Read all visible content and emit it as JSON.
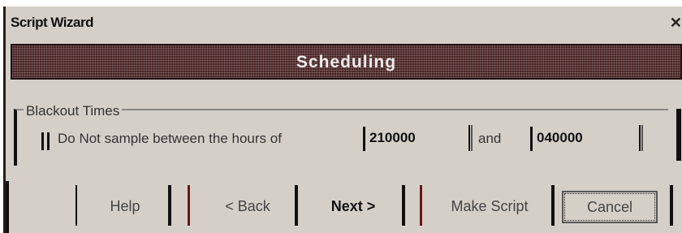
{
  "window": {
    "title": "Script Wizard",
    "close_glyph": "✕"
  },
  "banner": {
    "title": "Scheduling"
  },
  "blackout": {
    "group_label": "Blackout Times",
    "checkbox_label": "Do Not sample between the hours of",
    "start_time": "210000",
    "and_label": "and",
    "end_time": "040000",
    "checked": false
  },
  "buttons": {
    "help": "Help",
    "back": "< Back",
    "next": "Next >",
    "make_script": "Make Script",
    "cancel": "Cancel"
  },
  "colors": {
    "face": "#d4d0c8",
    "banner": "#4a2525"
  }
}
